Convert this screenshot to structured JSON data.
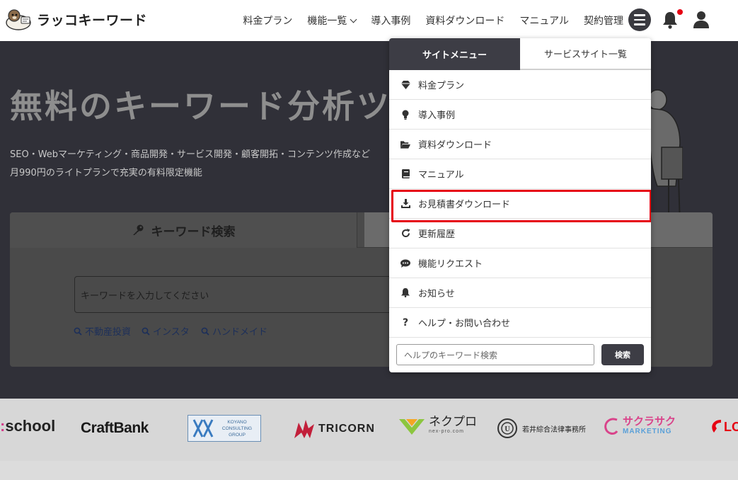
{
  "header": {
    "logo_text": "ラッコキーワード",
    "nav": {
      "pricing": "料金プラン",
      "features": "機能一覧",
      "cases": "導入事例",
      "downloads": "資料ダウンロード",
      "manual": "マニュアル",
      "contract": "契約管理"
    },
    "has_notification": true
  },
  "hero": {
    "title": "無料のキーワード分析ツー",
    "sub1": "SEO・Webマーケティング・商品開発・サービス開発・顧客開拓・コンテンツ作成など",
    "sub2": "月990円のライトプランで充実の有料限定機能"
  },
  "search": {
    "tab_keyword": "キーワード検索",
    "placeholder": "キーワードを入力してください",
    "suggestions": [
      "不動産投資",
      "インスタ",
      "ハンドメイド"
    ]
  },
  "logos": [
    "school",
    "CraftBank",
    "KOYANO CONSULTING GROUP",
    "TRICORN",
    "ネクプロ",
    "nex-pro.com",
    "若井綜合法律事務所",
    "サクラサク",
    "MARKETING",
    "LO"
  ],
  "menu": {
    "tab_site": "サイトメニュー",
    "tab_services": "サービスサイト一覧",
    "items": [
      {
        "label": "料金プラン",
        "icon": "gem-icon"
      },
      {
        "label": "導入事例",
        "icon": "lightbulb-icon"
      },
      {
        "label": "資料ダウンロード",
        "icon": "folder-open-icon"
      },
      {
        "label": "マニュアル",
        "icon": "book-icon"
      },
      {
        "label": "お見積書ダウンロード",
        "icon": "download-icon"
      },
      {
        "label": "更新履歴",
        "icon": "redo-icon"
      },
      {
        "label": "機能リクエスト",
        "icon": "comment-icon"
      },
      {
        "label": "お知らせ",
        "icon": "bell-icon"
      },
      {
        "label": "ヘルプ・お問い合わせ",
        "icon": "question-icon"
      }
    ],
    "help_placeholder": "ヘルプのキーワード検索",
    "help_button": "検索"
  },
  "colors": {
    "highlight": "#e60012",
    "dark": "#3d3d45"
  }
}
